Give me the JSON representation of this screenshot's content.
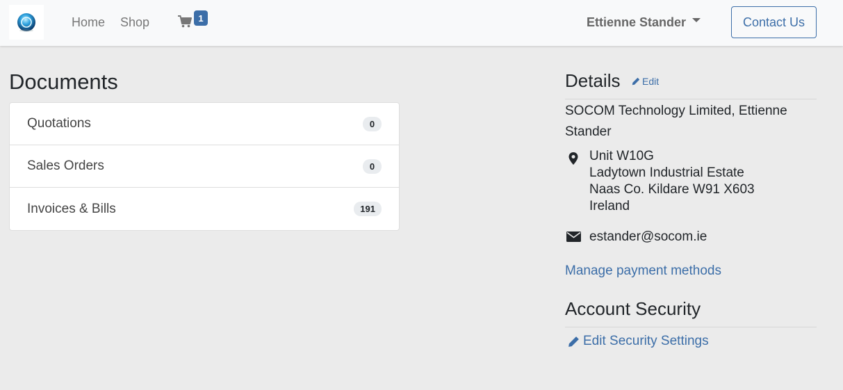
{
  "nav": {
    "logo_icon": "globe-logo-icon",
    "home": "Home",
    "shop": "Shop",
    "cart_icon": "cart-icon",
    "cart_count": "1",
    "user_name": "Ettienne Stander",
    "contact_label": "Contact Us"
  },
  "documents": {
    "title": "Documents",
    "items": [
      {
        "label": "Quotations",
        "count": "0"
      },
      {
        "label": "Sales Orders",
        "count": "0"
      },
      {
        "label": "Invoices & Bills",
        "count": "191"
      }
    ]
  },
  "details": {
    "title": "Details",
    "edit_label": "Edit",
    "company": "SOCOM Technology Limited, Ettienne Stander",
    "address_lines": [
      "Unit W10G",
      "Ladytown Industrial Estate",
      "Naas Co. Kildare W91 X603",
      "Ireland"
    ],
    "email": "estander@socom.ie",
    "manage_payment": "Manage payment methods"
  },
  "security": {
    "title": "Account Security",
    "edit_settings": "Edit Security Settings"
  },
  "colors": {
    "accent": "#3c6ea8",
    "background": "#ebebeb",
    "navbar": "#f8f9fa"
  }
}
